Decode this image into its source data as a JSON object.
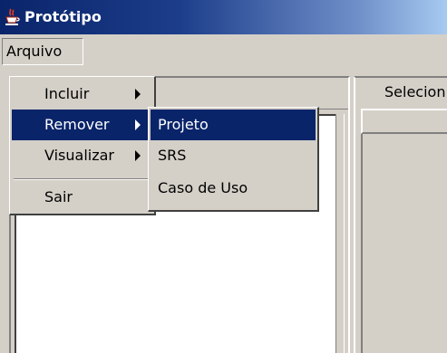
{
  "window": {
    "title": "Protótipo",
    "icon": "java-cup-icon"
  },
  "menubar": {
    "items": [
      {
        "label": "Arquivo"
      }
    ]
  },
  "dropdown": {
    "items": [
      {
        "label": "Incluir",
        "has_submenu": true,
        "selected": false
      },
      {
        "label": "Remover",
        "has_submenu": true,
        "selected": true
      },
      {
        "label": "Visualizar",
        "has_submenu": true,
        "selected": false
      },
      {
        "label": "Sair",
        "has_submenu": false,
        "selected": false
      }
    ]
  },
  "submenu": {
    "items": [
      {
        "label": "Projeto",
        "selected": true
      },
      {
        "label": "SRS",
        "selected": false
      },
      {
        "label": "Caso de Uso",
        "selected": false
      }
    ]
  },
  "right_panel": {
    "label": "Selecion"
  },
  "colors": {
    "titlebar_start": "#0a246a",
    "titlebar_end": "#a6caf0",
    "selection": "#0a246a",
    "face": "#d4d0c8"
  }
}
